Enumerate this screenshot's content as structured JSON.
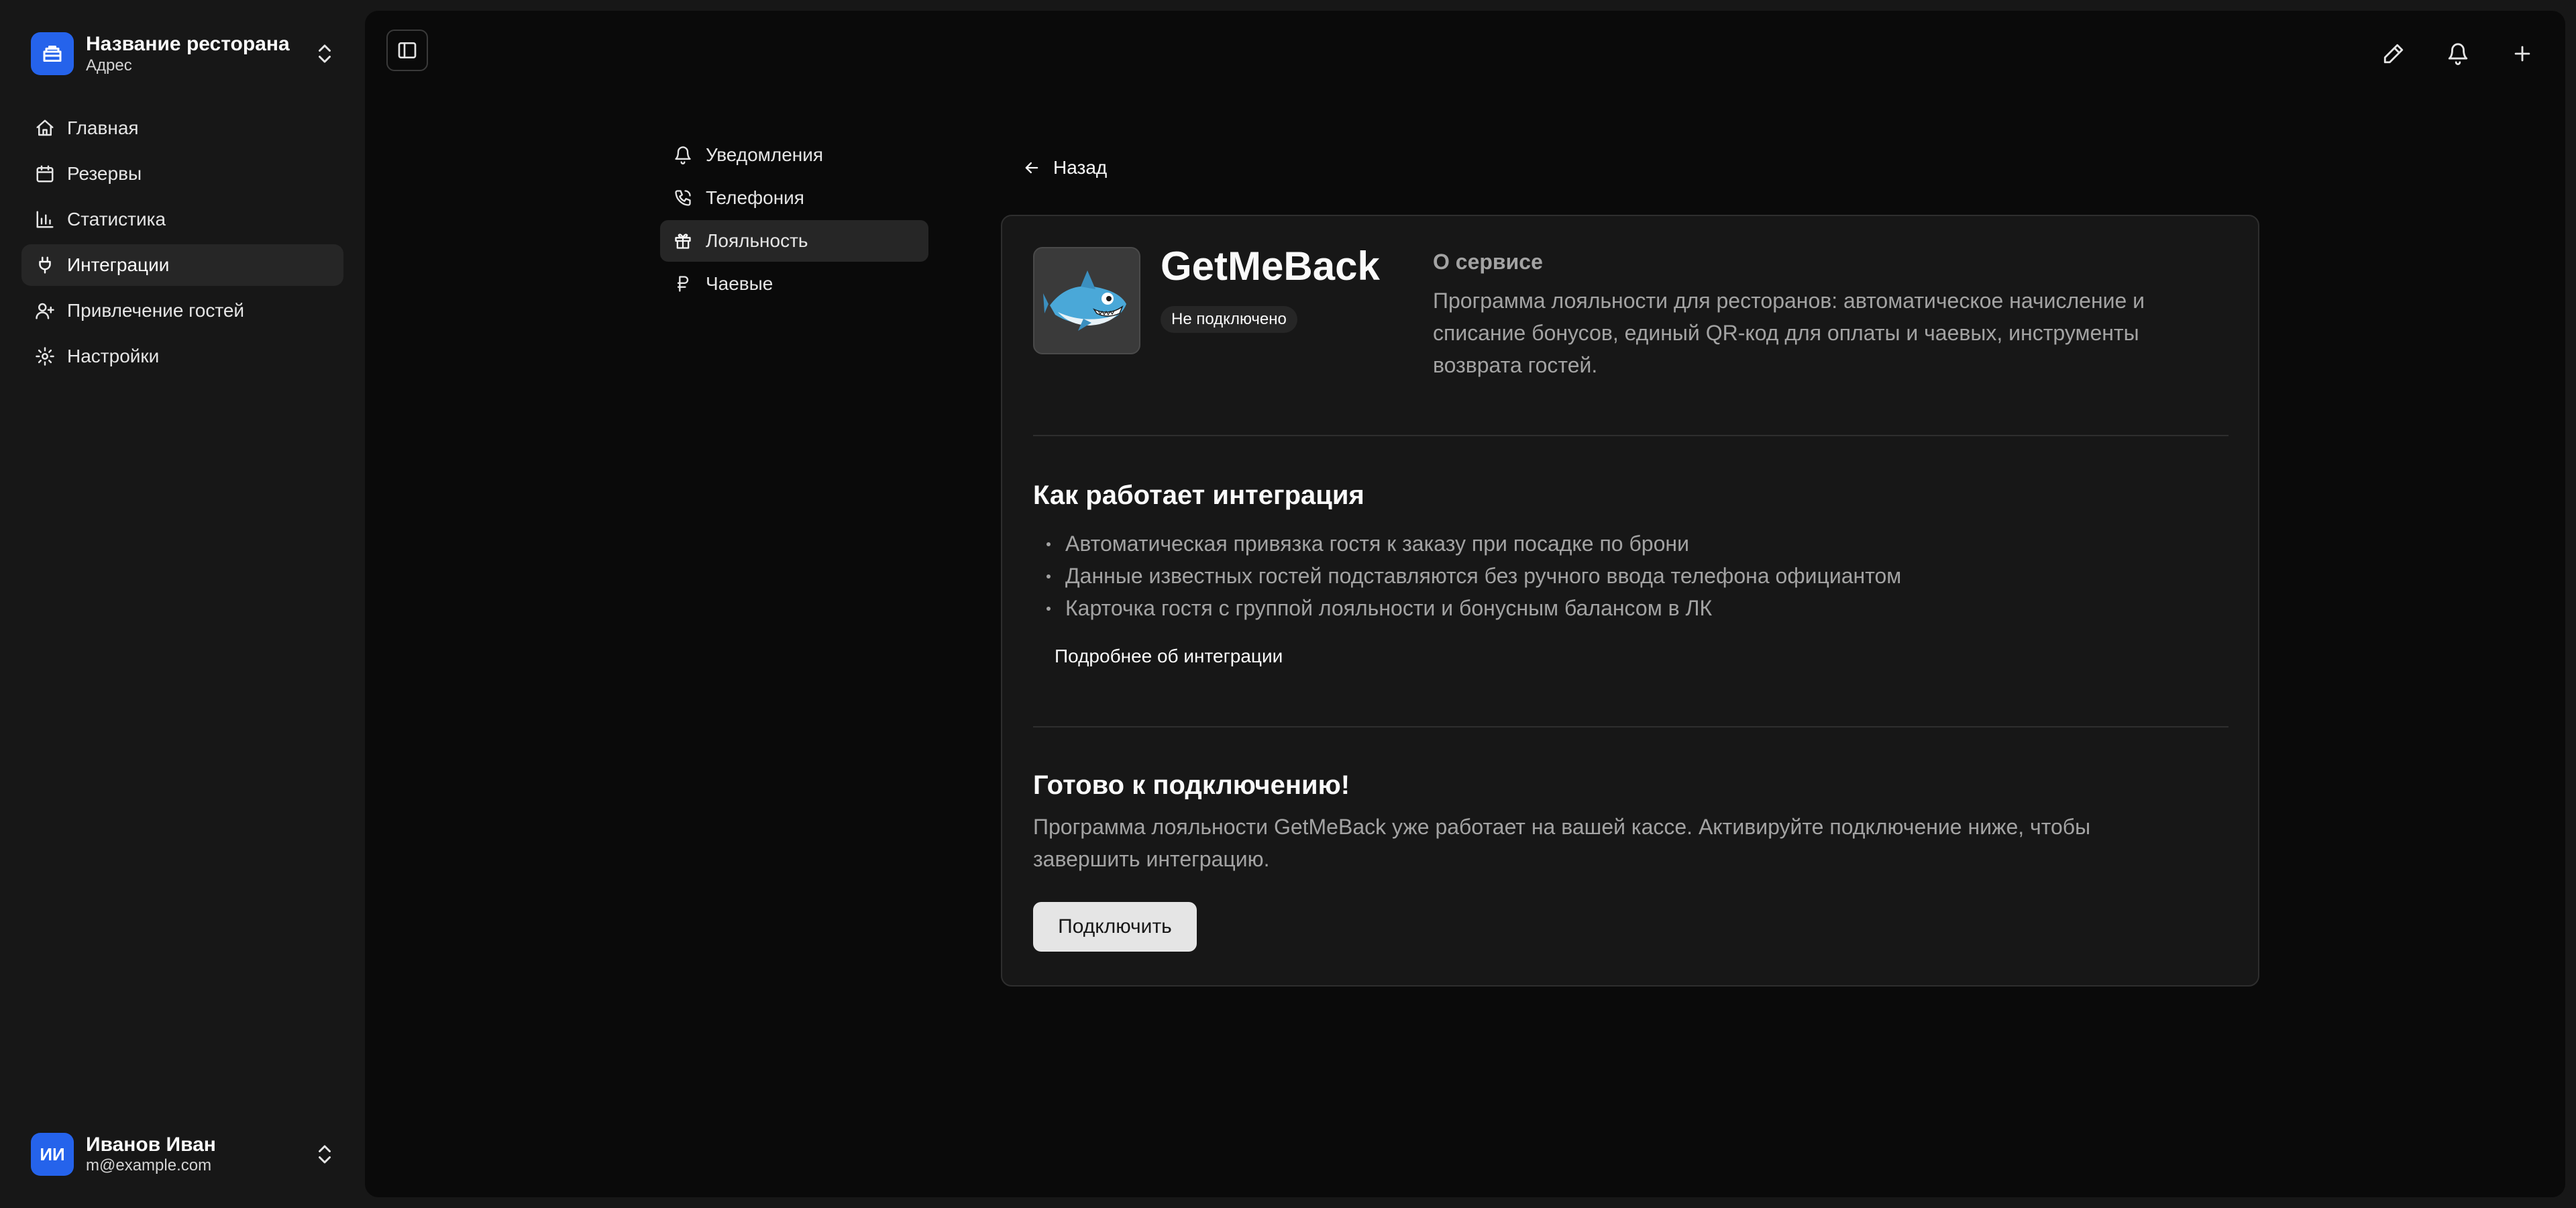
{
  "sidebar": {
    "restaurant_name": "Название ресторана",
    "restaurant_address": "Адрес",
    "nav": [
      {
        "label": "Главная",
        "icon": "home-icon"
      },
      {
        "label": "Резервы",
        "icon": "calendar-icon"
      },
      {
        "label": "Статистика",
        "icon": "bar-chart-icon"
      },
      {
        "label": "Интеграции",
        "icon": "plug-icon",
        "active": true
      },
      {
        "label": "Привлечение гостей",
        "icon": "user-plus-icon"
      },
      {
        "label": "Настройки",
        "icon": "gear-icon"
      }
    ],
    "user": {
      "initials": "ИИ",
      "name": "Иванов Иван",
      "email": "m@example.com"
    }
  },
  "subnav": [
    {
      "label": "Уведомления",
      "icon": "bell-icon"
    },
    {
      "label": "Телефония",
      "icon": "phone-icon"
    },
    {
      "label": "Лояльность",
      "icon": "gift-icon",
      "active": true
    },
    {
      "label": "Чаевые",
      "icon": "ruble-icon"
    }
  ],
  "back_label": "Назад",
  "service": {
    "name": "GetMeBack",
    "status": "Не подключено",
    "about_title": "О сервисе",
    "about_text": "Программа лояльности для ресторанов: автоматическое начисление и списание бонусов, единый QR-код для оплаты и чаевых, инструменты возврата гостей."
  },
  "how_it_works": {
    "title": "Как работает интеграция",
    "bullets": [
      "Автоматическая привязка гостя к заказу при посадке по брони",
      "Данные известных гостей подставляются без ручного ввода телефона официантом",
      "Карточка гостя с группой лояльности и бонусным балансом в ЛК"
    ],
    "more_link": "Подробнее об интеграции"
  },
  "ready": {
    "title": "Готово к подключению!",
    "text": "Программа лояльности GetMeBack уже работает на вашей кассе. Активируйте подключение ниже, чтобы завершить интеграцию.",
    "button": "Подключить"
  },
  "colors": {
    "accent": "#2563eb",
    "background": "#171717",
    "panel": "#0a0a0a",
    "muted_text": "#a3a3a3"
  }
}
